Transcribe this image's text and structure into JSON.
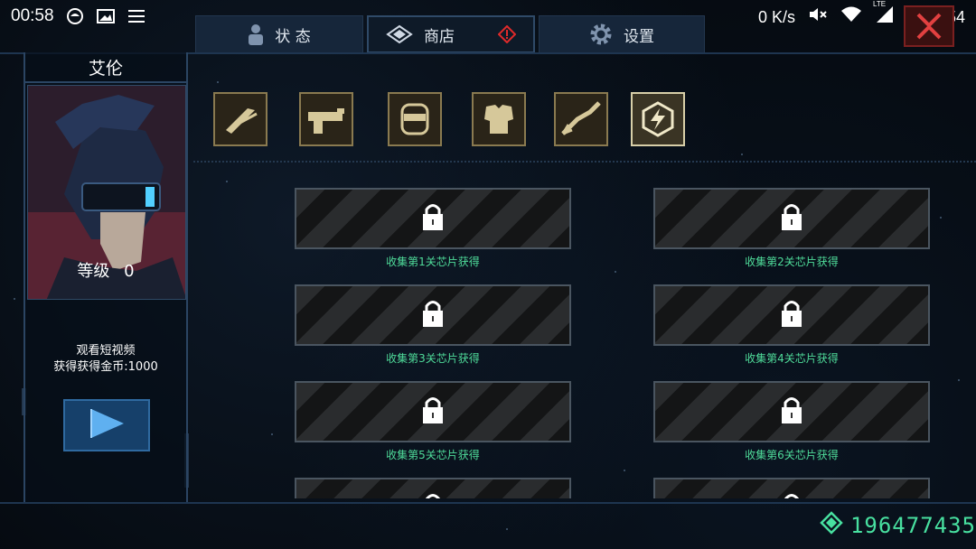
{
  "statusbar": {
    "time": "00:58",
    "network_speed": "0 K/s",
    "network_type": "LTE",
    "battery": "54"
  },
  "tabs": [
    {
      "label": "状 态",
      "icon": "person-icon"
    },
    {
      "label": "商店",
      "icon": "diamond-icon",
      "alert": true
    },
    {
      "label": "设置",
      "icon": "gear-icon"
    }
  ],
  "character": {
    "name": "艾伦",
    "level_label": "等级",
    "level_value": "0"
  },
  "reward": {
    "line1": "观看短视频",
    "line2": "获得获得金币:1000"
  },
  "categories": [
    {
      "icon": "blade-icon"
    },
    {
      "icon": "gun-icon"
    },
    {
      "icon": "helmet-icon"
    },
    {
      "icon": "armor-icon"
    },
    {
      "icon": "arm-icon"
    },
    {
      "icon": "energy-icon",
      "selected": true
    }
  ],
  "chips": [
    {
      "label": "收集第1关芯片获得"
    },
    {
      "label": "收集第2关芯片获得"
    },
    {
      "label": "收集第3关芯片获得"
    },
    {
      "label": "收集第4关芯片获得"
    },
    {
      "label": "收集第5关芯片获得"
    },
    {
      "label": "收集第6关芯片获得"
    }
  ],
  "currency": {
    "amount": "196477435"
  },
  "colors": {
    "accent_green": "#48e0a0",
    "tab_bg": "#16263a",
    "alert_red": "#e02a2a"
  }
}
